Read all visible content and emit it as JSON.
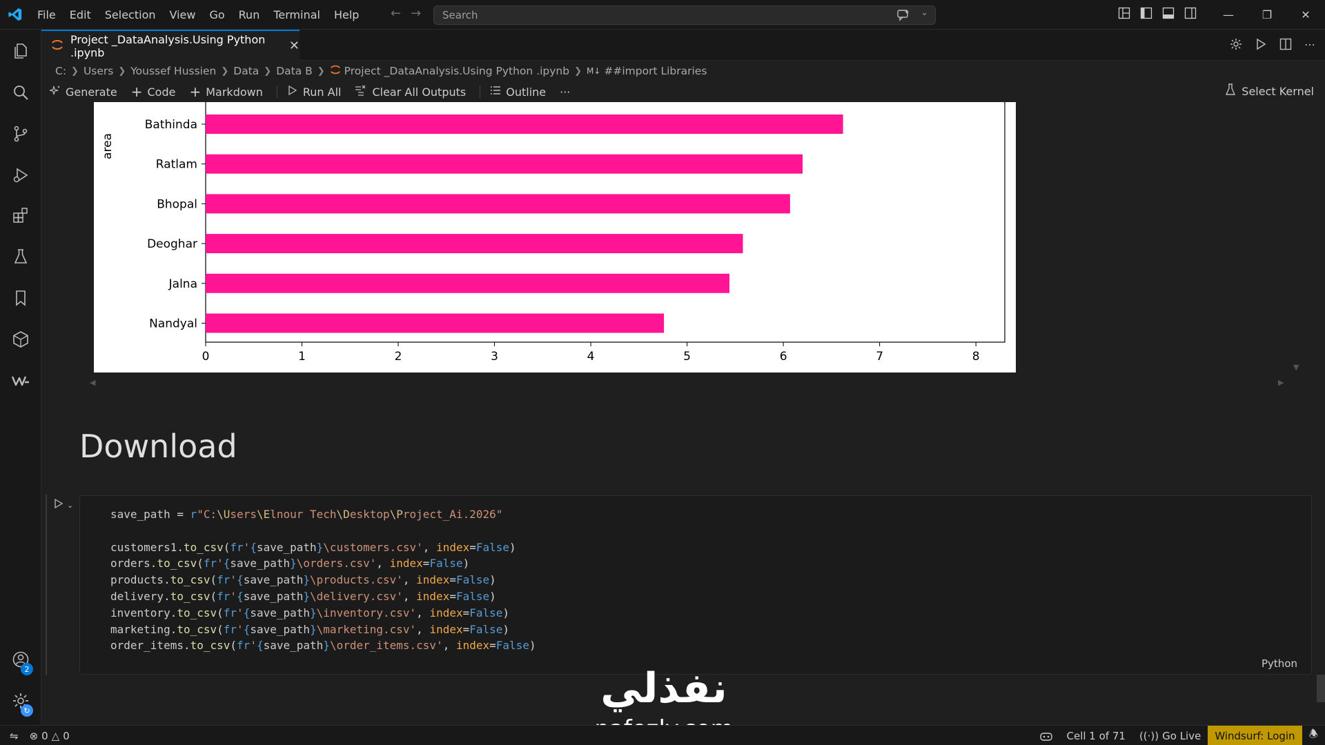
{
  "menu": [
    "File",
    "Edit",
    "Selection",
    "View",
    "Go",
    "Run",
    "Terminal",
    "Help"
  ],
  "search": {
    "placeholder": "Search"
  },
  "tab": {
    "title": "Project _DataAnalysis.Using Python .ipynb"
  },
  "breadcrumb": [
    "C:",
    "Users",
    "Youssef Hussien",
    "Data",
    "Data B",
    "Project _DataAnalysis.Using Python .ipynb",
    "##import Libraries"
  ],
  "toolbar": {
    "generate": "Generate",
    "code": "Code",
    "markdown": "Markdown",
    "run_all": "Run All",
    "clear_outputs": "Clear All Outputs",
    "outline": "Outline",
    "more": "···",
    "select_kernel": "Select Kernel"
  },
  "chart_data": {
    "type": "bar",
    "orientation": "horizontal",
    "ylabel": "area",
    "categories": [
      "Bathinda",
      "Ratlam",
      "Bhopal",
      "Deoghar",
      "Jalna",
      "Nandyal"
    ],
    "values": [
      6.62,
      6.2,
      6.07,
      5.58,
      5.44,
      4.76
    ],
    "xlim": [
      0,
      8.3
    ],
    "xticks": [
      "0",
      "1",
      "2",
      "3",
      "4",
      "5",
      "6",
      "7",
      "8"
    ],
    "bar_color": "#ff1493"
  },
  "markdown_heading": "Download",
  "code_cell": {
    "language": "Python",
    "lines": [
      "save_path = r\"C:\\Users\\Elnour Tech\\Desktop\\Project_Ai.2026\"",
      "",
      "customers1.to_csv(fr'{save_path}\\customers.csv', index=False)",
      "orders.to_csv(fr'{save_path}\\orders.csv', index=False)",
      "products.to_csv(fr'{save_path}\\products.csv', index=False)",
      "delivery.to_csv(fr'{save_path}\\delivery.csv', index=False)",
      "inventory.to_csv(fr'{save_path}\\inventory.csv', index=False)",
      "marketing.to_csv(fr'{save_path}\\marketing.csv', index=False)",
      "order_items.to_csv(fr'{save_path}\\order_items.csv', index=False)"
    ]
  },
  "watermark": {
    "arabic": "نفذلي",
    "latin": "nafezly.com"
  },
  "statusbar": {
    "errors": "0",
    "warnings": "0",
    "cell_position": "Cell 1 of 71",
    "go_live": "Go Live",
    "windsurf": "Windsurf: Login"
  },
  "accounts_badge": "2",
  "colors": {
    "accent": "#0078d4",
    "windsurf": "#c09800",
    "bar": "#ff1493"
  }
}
